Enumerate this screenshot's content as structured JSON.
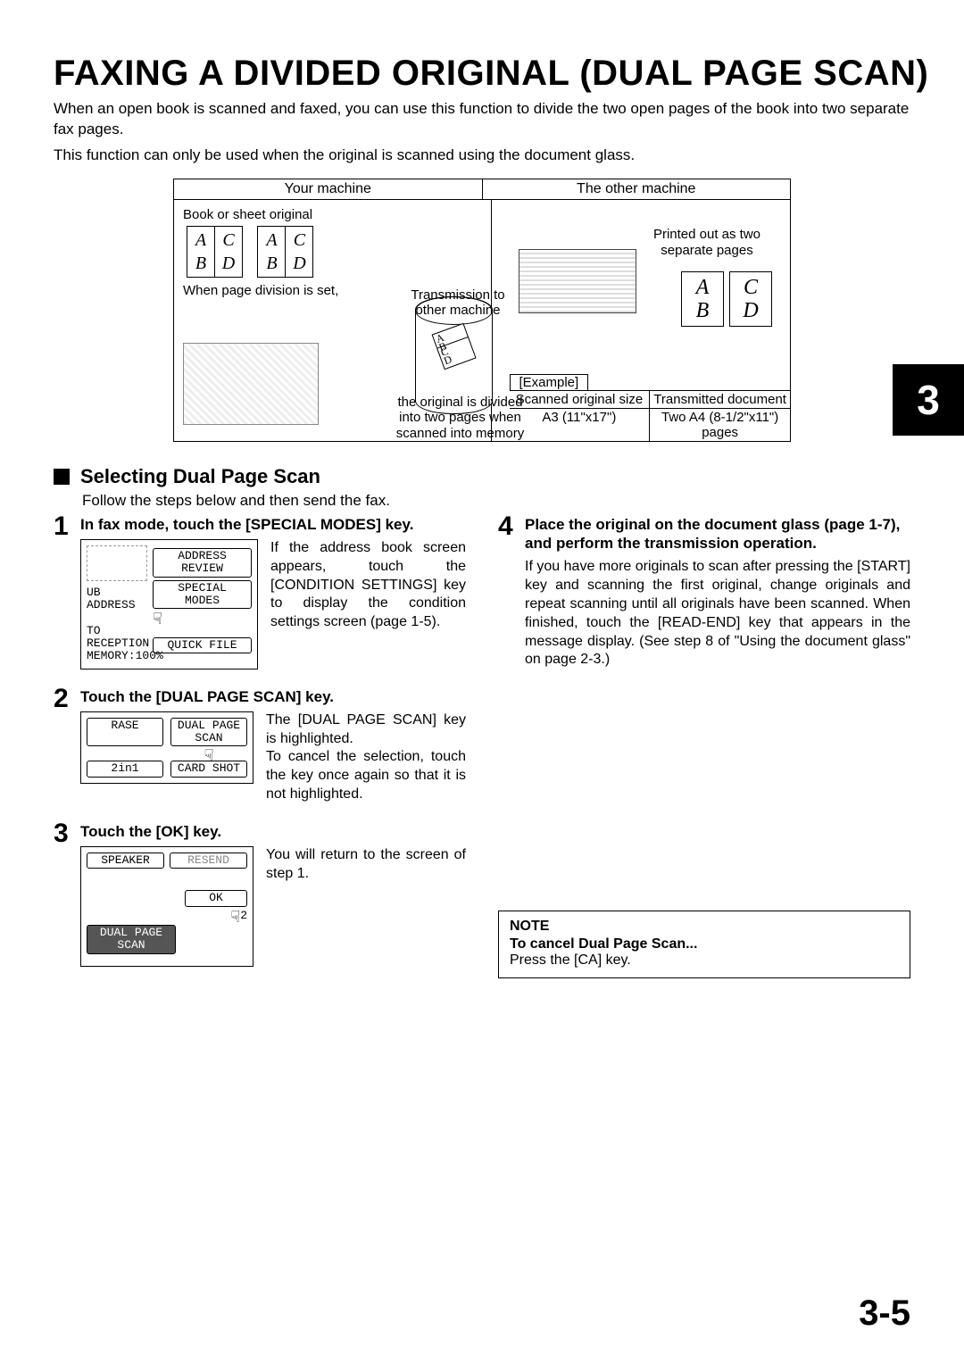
{
  "title": "FAXING A DIVIDED ORIGINAL  (DUAL PAGE SCAN)",
  "intro1": "When an open book is scanned and faxed, you can use this function to divide the two open pages of the book into two separate fax pages.",
  "intro2": "This function can only be used when the original is scanned using the document glass.",
  "diagram": {
    "your_machine": "Your machine",
    "other_machine": "The other machine",
    "book_label": "Book or sheet original",
    "when_set": "When page division is set,",
    "transmission": "Transmission to other machine",
    "divided": "the original is divided into two pages when scanned into memory",
    "printed": "Printed out as two separate pages",
    "letters": {
      "a": "A",
      "b": "B",
      "c": "C",
      "d": "D"
    },
    "example_label": "[Example]",
    "scanned_size_h": "Scanned original size",
    "transmitted_h": "Transmitted document",
    "scanned_size_v": "A3 (11\"x17\")",
    "transmitted_v": "Two A4 (8-1/2\"x11\") pages"
  },
  "chapter": "3",
  "section_title": "Selecting Dual Page Scan",
  "section_lead": "Follow the steps below and then send the fax.",
  "steps": {
    "s1": {
      "num": "1",
      "title": "In fax mode, touch the [SPECIAL MODES] key.",
      "text": "If the address book screen appears, touch the [CONDITION SETTINGS] key to display the condition settings screen (page 1-5).",
      "panel": {
        "sub_address": "UB ADDRESS",
        "reception": "TO RECEPTION",
        "memory": "MEMORY:100%",
        "address_review": "ADDRESS REVIEW",
        "special_modes": "SPECIAL MODES",
        "quick_file": "QUICK FILE"
      }
    },
    "s2": {
      "num": "2",
      "title": "Touch the [DUAL PAGE SCAN] key.",
      "text": "The [DUAL PAGE SCAN] key is highlighted.\nTo cancel the selection, touch the key once again so that it is not highlighted.",
      "panel": {
        "erase": "RASE",
        "dual_page": "DUAL PAGE SCAN",
        "two_in_one": "2in1",
        "card_shot": "CARD SHOT"
      }
    },
    "s3": {
      "num": "3",
      "title": "Touch the [OK] key.",
      "text": "You will return to the screen of step 1.",
      "panel": {
        "speaker": "SPEAKER",
        "resend": "RESEND",
        "ok": "OK",
        "dual_page": "DUAL PAGE SCAN"
      }
    },
    "s4": {
      "num": "4",
      "title": "Place the original on the document glass (page 1-7), and perform the transmission operation.",
      "text": "If you have more originals to scan after pressing the [START] key and scanning the first original, change originals and repeat scanning until all originals have been scanned. When finished, touch the [READ-END] key that appears in the message display. (See step 8 of \"Using the document glass\" on page 2-3.)"
    }
  },
  "note": {
    "heading": "NOTE",
    "sub": "To cancel Dual Page Scan...",
    "body": "Press the [CA] key."
  },
  "page_number": "3-5"
}
